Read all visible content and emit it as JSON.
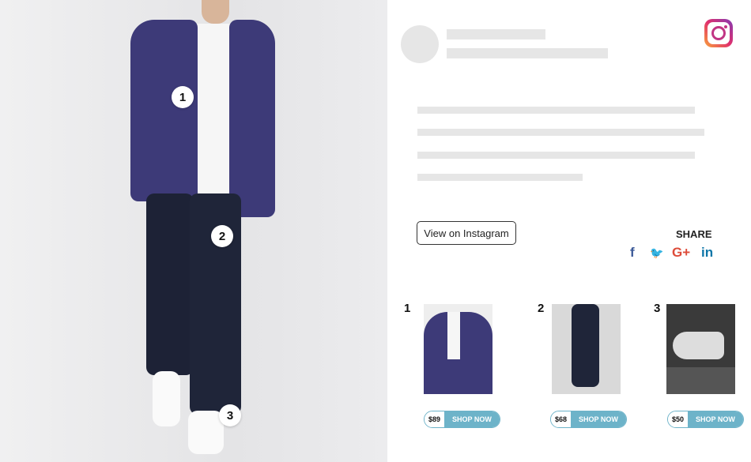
{
  "hotspots": [
    "1",
    "2",
    "3"
  ],
  "post": {
    "view_button": "View on Instagram",
    "share_label": "SHARE"
  },
  "social": [
    {
      "name": "facebook-icon",
      "glyph": "f",
      "color": "#3b5998"
    },
    {
      "name": "twitter-icon",
      "glyph": "🐦",
      "color": "#55acee"
    },
    {
      "name": "google-plus-icon",
      "glyph": "G+",
      "color": "#dd4b39"
    },
    {
      "name": "linkedin-icon",
      "glyph": "in",
      "color": "#0e76a8"
    }
  ],
  "products": [
    {
      "num": "1",
      "price": "$89",
      "cta": "SHOP NOW"
    },
    {
      "num": "2",
      "price": "$68",
      "cta": "SHOP NOW"
    },
    {
      "num": "3",
      "price": "$50",
      "cta": "SHOP NOW"
    }
  ],
  "colors": {
    "accent": "#6db3c9",
    "placeholder": "#e6e6e6"
  }
}
